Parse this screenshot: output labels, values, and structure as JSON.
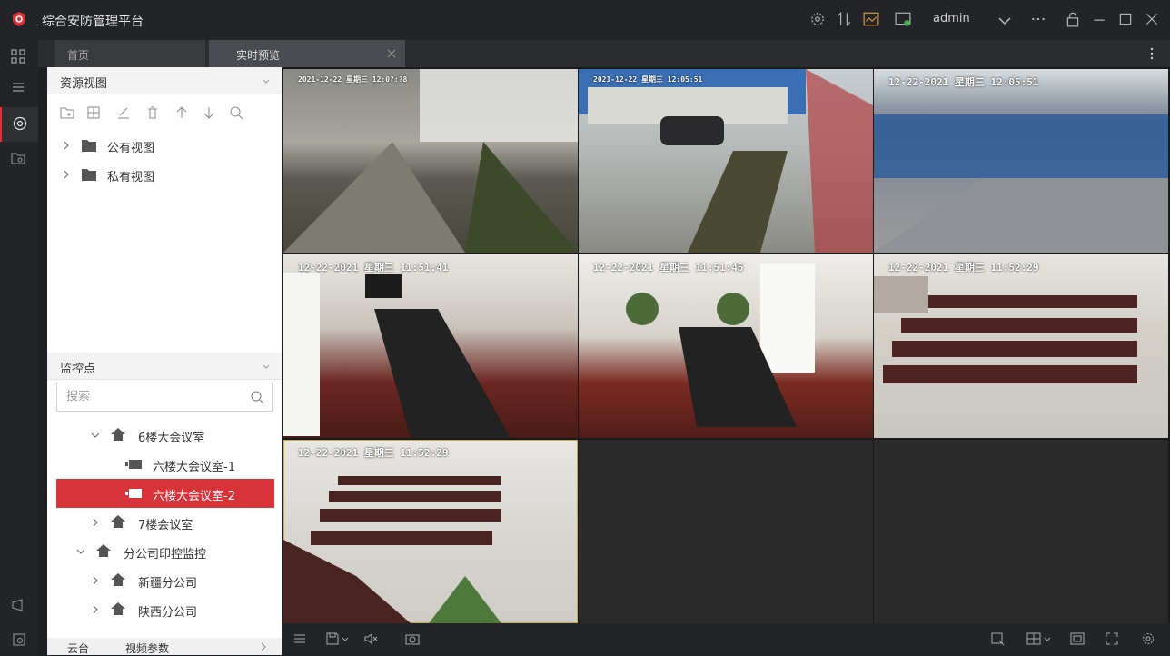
{
  "app": {
    "title": "综合安防管理平台",
    "user": "admin"
  },
  "tabs": [
    {
      "label": "首页"
    },
    {
      "label": "实时预览"
    }
  ],
  "resource_view": {
    "title": "资源视图",
    "items": [
      {
        "label": "公有视图"
      },
      {
        "label": "私有视图"
      }
    ]
  },
  "monitor": {
    "title": "监控点",
    "search_placeholder": "搜索",
    "tree": [
      {
        "label": "6楼大会议室"
      },
      {
        "label": "六楼大会议室-1"
      },
      {
        "label": "六楼大会议室-2"
      },
      {
        "label": "7楼会议室"
      },
      {
        "label": "分公司印控监控"
      },
      {
        "label": "新疆分公司"
      },
      {
        "label": "陕西分公司"
      }
    ]
  },
  "footer_tabs": {
    "ptz": "云台",
    "video_params": "视频参数"
  },
  "video": {
    "cells": [
      {
        "osd": "2021-12-22 星期三 12:0?:?8"
      },
      {
        "osd": "2021-12-22 星期三 12:05:51"
      },
      {
        "osd": "12-22-2021 星期三 12:05:51"
      },
      {
        "osd": "12-22-2021 星期三 11:51:41"
      },
      {
        "osd": "12-22-2021 星期三 11:51:45"
      },
      {
        "osd": "12-22-2021 星期三 11:52:29"
      },
      {
        "osd": "12-22-2021 星期三 11:52:29"
      },
      {
        "osd": ""
      },
      {
        "osd": ""
      }
    ],
    "selected_index": 6,
    "empty_indices": [
      7,
      8
    ]
  },
  "colors": {
    "accent": "#d9333a",
    "titlebar": "#232427",
    "panel": "#ffffff",
    "selected_frame": "#c9a94b"
  }
}
